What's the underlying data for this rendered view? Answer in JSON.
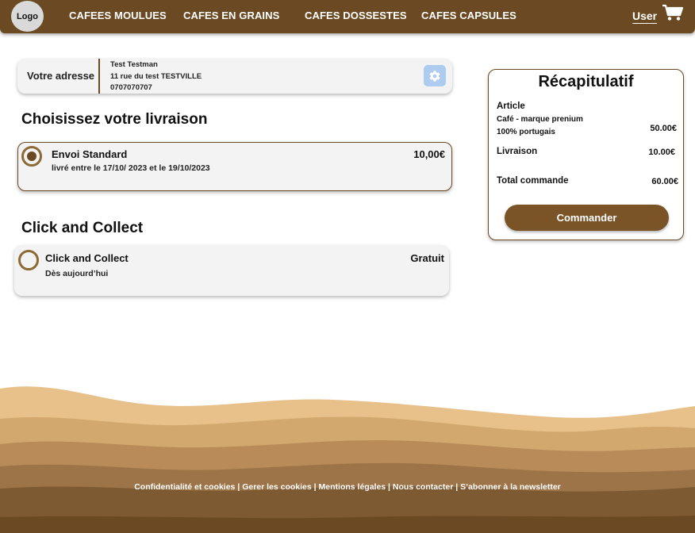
{
  "header": {
    "logo": "Logo",
    "nav": [
      "CAFEES MOULUES",
      "CAFES EN GRAINS",
      "CAFES DOSSESTES",
      "CAFES CAPSULES"
    ],
    "user": "User",
    "cart_icon": "shopping-cart-icon"
  },
  "address": {
    "label": "Votre adresse",
    "name": "Test Testman",
    "street": "11 rue du test TESTVILLE",
    "phone": "0707070707",
    "edit_icon": "gear-icon"
  },
  "delivery": {
    "title": "Choisissez votre livraison",
    "standard": {
      "title": "Envoi Standard",
      "subtitle": "livré entre le 17/10/ 2023 et le 19/10/2023",
      "price": "10,00€",
      "selected": true
    }
  },
  "collect": {
    "title": "Click and Collect",
    "option_title": "Click and Collect",
    "subtitle": "Dès aujourd’hui",
    "price": "Gratuit",
    "selected": false
  },
  "summary": {
    "title": "Récapitulatif",
    "article_label": "Article",
    "article_line1": "Café - marque prenium",
    "article_line2": "100% portugais",
    "article_price": "50.00€",
    "delivery_label": "Livraison",
    "delivery_price": "10.00€",
    "total_label": "Total commande",
    "total_price": "60.00€",
    "order_button": "Commander"
  },
  "footer": {
    "links": [
      "Confidentialité et cookies",
      "Gerer les cookies",
      "Mentions légales",
      "Nous contacter",
      "S’abonner à la newsletter"
    ],
    "separator": " | ",
    "colors": [
      "#e8c08a",
      "#d2a86f",
      "#b88b58",
      "#9c7447",
      "#7e5a33",
      "#6b4a23"
    ]
  },
  "colors": {
    "brand_brown": "#6b4a23",
    "gear_button": "#aecbf0"
  }
}
